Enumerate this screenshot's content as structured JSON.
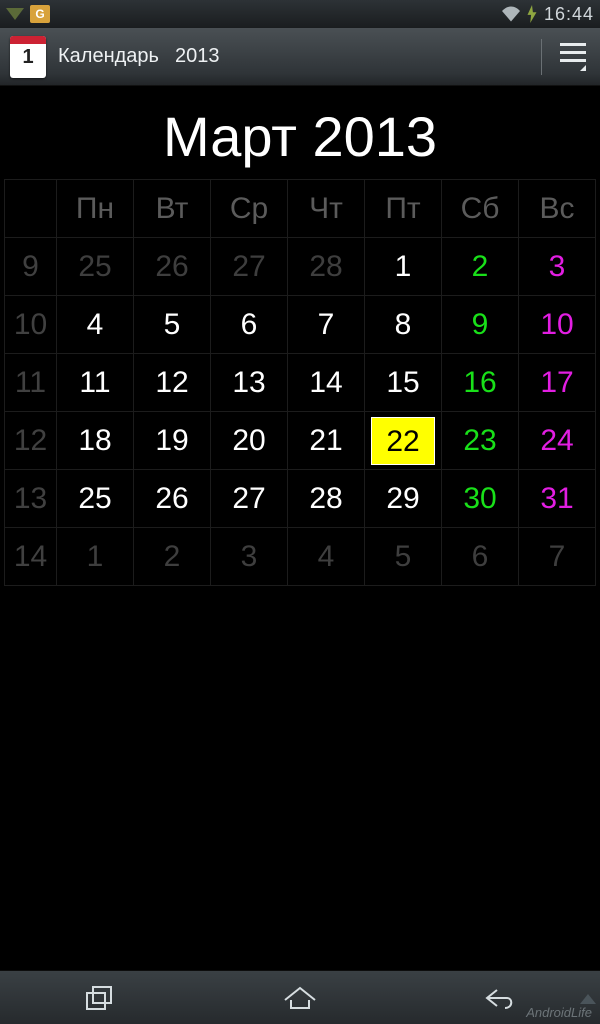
{
  "status": {
    "time": "16:44"
  },
  "header": {
    "app_name": "Календарь",
    "year": "2013"
  },
  "title": "Март 2013",
  "weekdays": [
    "Пн",
    "Вт",
    "Ср",
    "Чт",
    "Пт",
    "Сб",
    "Вс"
  ],
  "weeks": [
    {
      "num": "9",
      "days": [
        {
          "d": "25",
          "t": "out"
        },
        {
          "d": "26",
          "t": "out"
        },
        {
          "d": "27",
          "t": "out"
        },
        {
          "d": "28",
          "t": "out"
        },
        {
          "d": "1",
          "t": "in"
        },
        {
          "d": "2",
          "t": "sat"
        },
        {
          "d": "3",
          "t": "sun"
        }
      ]
    },
    {
      "num": "10",
      "days": [
        {
          "d": "4",
          "t": "in"
        },
        {
          "d": "5",
          "t": "in"
        },
        {
          "d": "6",
          "t": "in"
        },
        {
          "d": "7",
          "t": "in"
        },
        {
          "d": "8",
          "t": "in"
        },
        {
          "d": "9",
          "t": "sat"
        },
        {
          "d": "10",
          "t": "sun"
        }
      ]
    },
    {
      "num": "11",
      "days": [
        {
          "d": "11",
          "t": "in"
        },
        {
          "d": "12",
          "t": "in"
        },
        {
          "d": "13",
          "t": "in"
        },
        {
          "d": "14",
          "t": "in"
        },
        {
          "d": "15",
          "t": "in"
        },
        {
          "d": "16",
          "t": "sat"
        },
        {
          "d": "17",
          "t": "sun"
        }
      ]
    },
    {
      "num": "12",
      "days": [
        {
          "d": "18",
          "t": "in"
        },
        {
          "d": "19",
          "t": "in"
        },
        {
          "d": "20",
          "t": "in"
        },
        {
          "d": "21",
          "t": "in"
        },
        {
          "d": "22",
          "t": "today"
        },
        {
          "d": "23",
          "t": "sat"
        },
        {
          "d": "24",
          "t": "sun"
        }
      ]
    },
    {
      "num": "13",
      "days": [
        {
          "d": "25",
          "t": "in"
        },
        {
          "d": "26",
          "t": "in"
        },
        {
          "d": "27",
          "t": "in"
        },
        {
          "d": "28",
          "t": "in"
        },
        {
          "d": "29",
          "t": "in"
        },
        {
          "d": "30",
          "t": "sat"
        },
        {
          "d": "31",
          "t": "sun"
        }
      ]
    },
    {
      "num": "14",
      "days": [
        {
          "d": "1",
          "t": "out"
        },
        {
          "d": "2",
          "t": "out"
        },
        {
          "d": "3",
          "t": "out"
        },
        {
          "d": "4",
          "t": "out"
        },
        {
          "d": "5",
          "t": "out"
        },
        {
          "d": "6",
          "t": "out"
        },
        {
          "d": "7",
          "t": "out"
        }
      ]
    }
  ],
  "watermark": "AndroidLife"
}
